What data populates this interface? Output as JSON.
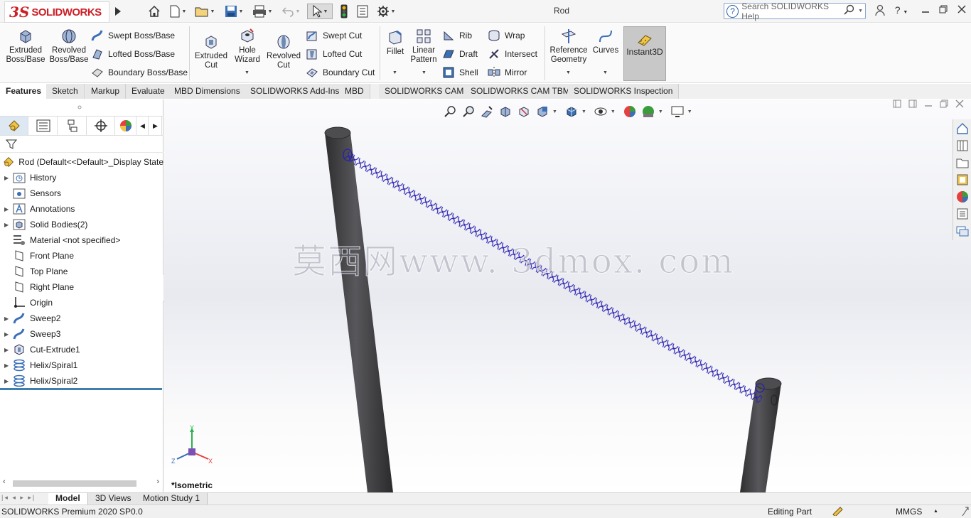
{
  "app": {
    "logo_prefix": "3S",
    "logo_text": "SOLIDWORKS",
    "doc_title": "Rod"
  },
  "search": {
    "placeholder": "Search SOLIDWORKS Help"
  },
  "commands": {
    "extruded_boss": "Extruded Boss/Base",
    "revolved_boss": "Revolved Boss/Base",
    "swept_boss": "Swept Boss/Base",
    "lofted_boss": "Lofted Boss/Base",
    "boundary_boss": "Boundary Boss/Base",
    "extruded_cut": "Extruded Cut",
    "hole_wizard": "Hole Wizard",
    "revolved_cut": "Revolved Cut",
    "swept_cut": "Swept Cut",
    "lofted_cut": "Lofted Cut",
    "boundary_cut": "Boundary Cut",
    "fillet": "Fillet",
    "linear_pattern": "Linear Pattern",
    "rib": "Rib",
    "draft": "Draft",
    "shell": "Shell",
    "wrap": "Wrap",
    "intersect": "Intersect",
    "mirror": "Mirror",
    "reference_geometry": "Reference Geometry",
    "curves": "Curves",
    "instant3d": "Instant3D"
  },
  "tabs": [
    "Features",
    "Sketch",
    "Markup",
    "Evaluate",
    "MBD Dimensions",
    "SOLIDWORKS Add-Ins",
    "MBD",
    "SOLIDWORKS CAM",
    "SOLIDWORKS CAM TBM",
    "SOLIDWORKS Inspection"
  ],
  "tree": {
    "root": "Rod  (Default<<Default>_Display State",
    "items": [
      "History",
      "Sensors",
      "Annotations",
      "Solid Bodies(2)",
      "Material <not specified>",
      "Front Plane",
      "Top Plane",
      "Right Plane",
      "Origin",
      "Sweep2",
      "Sweep3",
      "Cut-Extrude1",
      "Helix/Spiral1",
      "Helix/Spiral2"
    ]
  },
  "viewport": {
    "watermark": "莫西网www. 3dmox. com",
    "view_label": "*Isometric",
    "axis_x": "X",
    "axis_y": "Y",
    "axis_z": "Z"
  },
  "bottom_tabs": [
    "Model",
    "3D Views",
    "Motion Study 1"
  ],
  "status": {
    "product": "SOLIDWORKS Premium 2020 SP0.0",
    "mode": "Editing Part",
    "units": "MMGS"
  },
  "colors": {
    "accent": "#cc1f26",
    "spring": "#2a1fb0",
    "rod": "#4a4a4d",
    "selection_blue": "#3f7fae"
  }
}
